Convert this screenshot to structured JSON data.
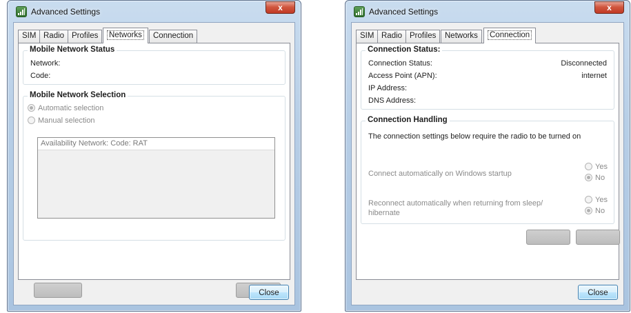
{
  "left_dialog": {
    "title": "Advanced Settings",
    "close_glyph": "x",
    "tabs": [
      "SIM",
      "Radio",
      "Profiles",
      "Networks",
      "Connection"
    ],
    "active_tab": "Networks",
    "status_group": {
      "title": "Mobile Network Status",
      "network_label": "Network:",
      "code_label": "Code:"
    },
    "selection_group": {
      "title": "Mobile Network Selection",
      "automatic_label": "Automatic selection",
      "manual_label": "Manual selection",
      "list_header": "Availability Network: Code: RAT"
    },
    "close_button": "Close"
  },
  "right_dialog": {
    "title": "Advanced Settings",
    "close_glyph": "x",
    "tabs": [
      "SIM",
      "Radio",
      "Profiles",
      "Networks",
      "Connection"
    ],
    "active_tab": "Connection",
    "status_group": {
      "title": "Connection Status:",
      "rows": [
        {
          "label": "Connection Status:",
          "value": "Disconnected"
        },
        {
          "label": "Access Point (APN):",
          "value": "internet"
        },
        {
          "label": "IP Address:",
          "value": ""
        },
        {
          "label": "DNS Address:",
          "value": ""
        }
      ]
    },
    "handling_group": {
      "title": "Connection Handling",
      "note": "The connection settings below require the radio to be turned on",
      "startup_label": "Connect automatically on Windows startup",
      "reconnect_label": "Reconnect automatically when returning from sleep/ hibernate",
      "yes_label": "Yes",
      "no_label": "No"
    },
    "close_button": "Close"
  },
  "icons": [
    "signal-bars-icon",
    "close-icon",
    "radio-icon"
  ]
}
